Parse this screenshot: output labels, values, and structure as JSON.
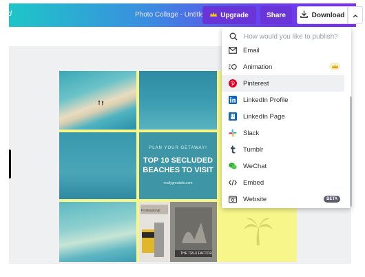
{
  "header": {
    "cut_text": "d",
    "doc_title": "Photo Collage - Untitled",
    "upgrade_label": "Upgrade",
    "share_label": "Share",
    "download_label": "Download"
  },
  "colors": {
    "header_gradient": [
      "#1ec6c8",
      "#3b8de0",
      "#6a3df0",
      "#7b2ff3"
    ],
    "accent_button": "#6a35d6",
    "collage_yellow": "#f7f68a"
  },
  "collage": {
    "tagline": "PLAN YOUR GETAWAY!",
    "headline_line1": "TOP 10 SECLUDED",
    "headline_line2": "BEACHES TO VISIT",
    "site": "reallygreatsite.com",
    "photo_text_1": "Professional",
    "photo_text_2": "THE TRI-X FACTOR"
  },
  "publish_menu": {
    "search_placeholder": "How would you like to publish?",
    "items": [
      {
        "label": "Email",
        "icon": "email-icon"
      },
      {
        "label": "Animation",
        "icon": "animation-icon",
        "badge": "crown"
      },
      {
        "label": "Pinterest",
        "icon": "pinterest-icon",
        "highlighted": true
      },
      {
        "label": "LinkedIn Profile",
        "icon": "linkedin-icon"
      },
      {
        "label": "LinkedIn Page",
        "icon": "linkedin-page-icon"
      },
      {
        "label": "Slack",
        "icon": "slack-icon"
      },
      {
        "label": "Tumblr",
        "icon": "tumblr-icon"
      },
      {
        "label": "WeChat",
        "icon": "wechat-icon"
      },
      {
        "label": "Embed",
        "icon": "embed-icon"
      },
      {
        "label": "Website",
        "icon": "website-icon",
        "badge": "BETA"
      }
    ]
  }
}
